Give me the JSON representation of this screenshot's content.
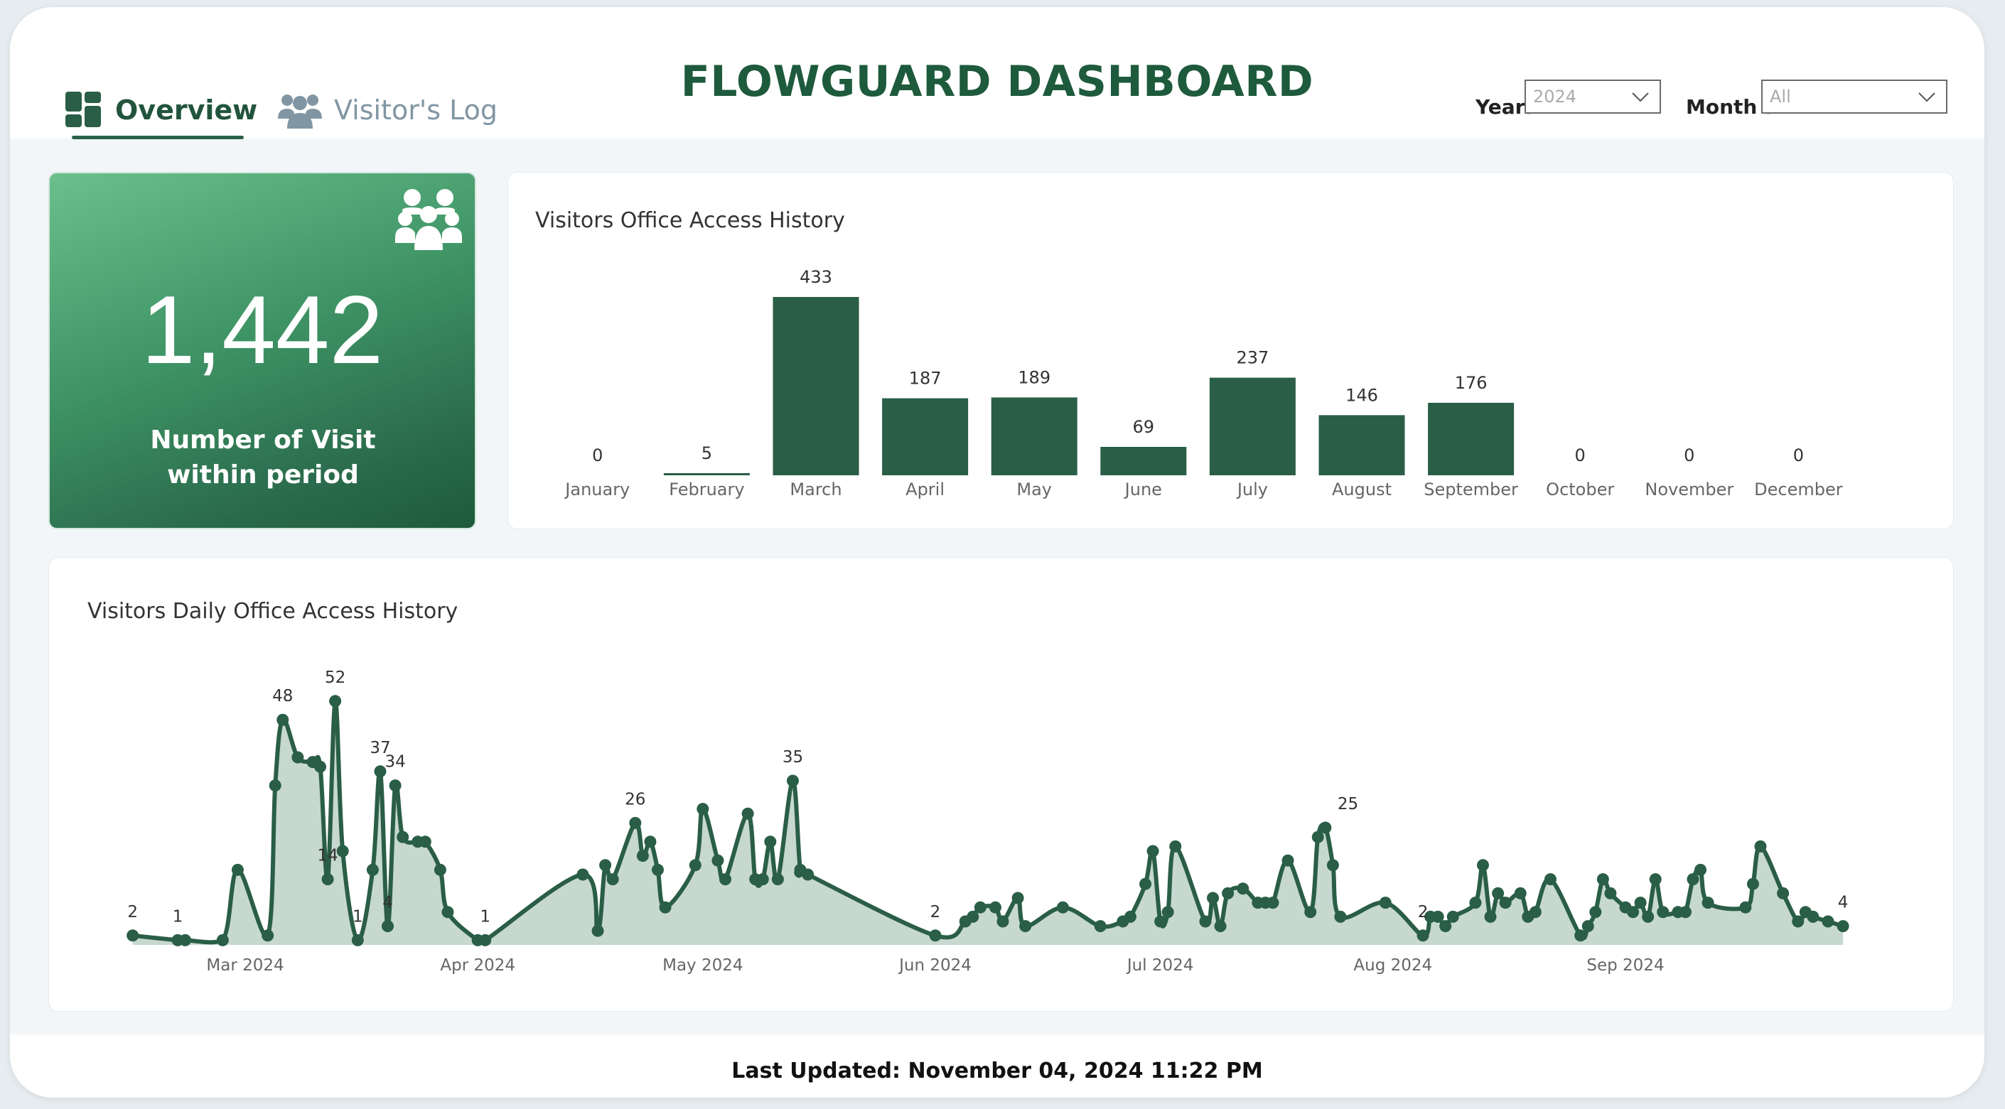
{
  "header": {
    "title": "FLOWGUARD DASHBOARD",
    "tabs": [
      {
        "label": "Overview",
        "icon": "dashboard-icon",
        "active": true
      },
      {
        "label": "Visitor's Log",
        "icon": "users-icon",
        "active": false
      }
    ]
  },
  "filters": {
    "year_label": "Year:",
    "year_value": "2024",
    "month_label": "Month :",
    "month_value": "All"
  },
  "kpi": {
    "value": "1,442",
    "label": "Number of Visit within period",
    "icon": "group-icon"
  },
  "monthly_chart_title": "Visitors Office Access History",
  "daily_chart_title": "Visitors Daily Office Access History",
  "footer": {
    "last_updated": "Last Updated: November 04, 2024 11:22 PM"
  },
  "colors": {
    "primary": "#2a5e46",
    "area_fill": "#c3d6cc",
    "title": "#1e5a3c"
  },
  "chart_data": [
    {
      "type": "bar",
      "title": "Visitors Office Access History",
      "categories": [
        "January",
        "February",
        "March",
        "April",
        "May",
        "June",
        "July",
        "August",
        "September",
        "October",
        "November",
        "December"
      ],
      "values": [
        0,
        5,
        433,
        187,
        189,
        69,
        237,
        146,
        176,
        0,
        0,
        0
      ],
      "ylim": [
        0,
        433
      ],
      "grid": false
    },
    {
      "type": "area",
      "title": "Visitors Daily Office Access History",
      "x_ticks": [
        "Mar 2024",
        "Apr 2024",
        "May 2024",
        "Jun 2024",
        "Jul 2024",
        "Aug 2024",
        "Sep 2024"
      ],
      "x_tick_dates": [
        "2024-03-01",
        "2024-04-01",
        "2024-05-01",
        "2024-06-01",
        "2024-07-01",
        "2024-08-01",
        "2024-09-01"
      ],
      "grid": false,
      "labeled_points": [
        {
          "date": "2024-02-15",
          "value": 2
        },
        {
          "date": "2024-02-21",
          "value": 1
        },
        {
          "date": "2024-03-06",
          "value": 48
        },
        {
          "date": "2024-03-12",
          "value": 14
        },
        {
          "date": "2024-03-13",
          "value": 52
        },
        {
          "date": "2024-03-16",
          "value": 1
        },
        {
          "date": "2024-03-19",
          "value": 37
        },
        {
          "date": "2024-03-20",
          "value": 4
        },
        {
          "date": "2024-03-21",
          "value": 34
        },
        {
          "date": "2024-04-02",
          "value": 1
        },
        {
          "date": "2024-04-22",
          "value": 26
        },
        {
          "date": "2024-05-13",
          "value": 35
        },
        {
          "date": "2024-06-01",
          "value": 2
        },
        {
          "date": "2024-07-26",
          "value": 25
        },
        {
          "date": "2024-08-05",
          "value": 2
        },
        {
          "date": "2024-09-30",
          "value": 4
        }
      ],
      "points": [
        {
          "date": "2024-02-15",
          "value": 2
        },
        {
          "date": "2024-02-21",
          "value": 1
        },
        {
          "date": "2024-02-22",
          "value": 1
        },
        {
          "date": "2024-02-27",
          "value": 1
        },
        {
          "date": "2024-02-29",
          "value": 16
        },
        {
          "date": "2024-03-04",
          "value": 2
        },
        {
          "date": "2024-03-05",
          "value": 34
        },
        {
          "date": "2024-03-06",
          "value": 48
        },
        {
          "date": "2024-03-08",
          "value": 40
        },
        {
          "date": "2024-03-10",
          "value": 39
        },
        {
          "date": "2024-03-11",
          "value": 38
        },
        {
          "date": "2024-03-12",
          "value": 14
        },
        {
          "date": "2024-03-13",
          "value": 52
        },
        {
          "date": "2024-03-14",
          "value": 20
        },
        {
          "date": "2024-03-16",
          "value": 1
        },
        {
          "date": "2024-03-18",
          "value": 16
        },
        {
          "date": "2024-03-19",
          "value": 37
        },
        {
          "date": "2024-03-20",
          "value": 4
        },
        {
          "date": "2024-03-21",
          "value": 34
        },
        {
          "date": "2024-03-22",
          "value": 23
        },
        {
          "date": "2024-03-24",
          "value": 22
        },
        {
          "date": "2024-03-25",
          "value": 22
        },
        {
          "date": "2024-03-27",
          "value": 16
        },
        {
          "date": "2024-03-28",
          "value": 7
        },
        {
          "date": "2024-04-01",
          "value": 1
        },
        {
          "date": "2024-04-02",
          "value": 1
        },
        {
          "date": "2024-04-15",
          "value": 15
        },
        {
          "date": "2024-04-17",
          "value": 3
        },
        {
          "date": "2024-04-18",
          "value": 17
        },
        {
          "date": "2024-04-19",
          "value": 14
        },
        {
          "date": "2024-04-22",
          "value": 26
        },
        {
          "date": "2024-04-23",
          "value": 19
        },
        {
          "date": "2024-04-24",
          "value": 22
        },
        {
          "date": "2024-04-25",
          "value": 16
        },
        {
          "date": "2024-04-26",
          "value": 8
        },
        {
          "date": "2024-04-30",
          "value": 17
        },
        {
          "date": "2024-05-01",
          "value": 29
        },
        {
          "date": "2024-05-03",
          "value": 18
        },
        {
          "date": "2024-05-04",
          "value": 14
        },
        {
          "date": "2024-05-07",
          "value": 28
        },
        {
          "date": "2024-05-08",
          "value": 14
        },
        {
          "date": "2024-05-09",
          "value": 14
        },
        {
          "date": "2024-05-10",
          "value": 22
        },
        {
          "date": "2024-05-11",
          "value": 14
        },
        {
          "date": "2024-05-13",
          "value": 35
        },
        {
          "date": "2024-05-14",
          "value": 16
        },
        {
          "date": "2024-05-15",
          "value": 15
        },
        {
          "date": "2024-06-01",
          "value": 2
        },
        {
          "date": "2024-06-05",
          "value": 5
        },
        {
          "date": "2024-06-06",
          "value": 6
        },
        {
          "date": "2024-06-07",
          "value": 8
        },
        {
          "date": "2024-06-09",
          "value": 8
        },
        {
          "date": "2024-06-10",
          "value": 5
        },
        {
          "date": "2024-06-12",
          "value": 10
        },
        {
          "date": "2024-06-13",
          "value": 4
        },
        {
          "date": "2024-06-18",
          "value": 8
        },
        {
          "date": "2024-06-23",
          "value": 4
        },
        {
          "date": "2024-06-26",
          "value": 5
        },
        {
          "date": "2024-06-27",
          "value": 6
        },
        {
          "date": "2024-06-29",
          "value": 13
        },
        {
          "date": "2024-06-30",
          "value": 20
        },
        {
          "date": "2024-07-01",
          "value": 5
        },
        {
          "date": "2024-07-02",
          "value": 7
        },
        {
          "date": "2024-07-03",
          "value": 21
        },
        {
          "date": "2024-07-07",
          "value": 5
        },
        {
          "date": "2024-07-08",
          "value": 10
        },
        {
          "date": "2024-07-09",
          "value": 4
        },
        {
          "date": "2024-07-10",
          "value": 11
        },
        {
          "date": "2024-07-12",
          "value": 12
        },
        {
          "date": "2024-07-14",
          "value": 9
        },
        {
          "date": "2024-07-15",
          "value": 9
        },
        {
          "date": "2024-07-16",
          "value": 9
        },
        {
          "date": "2024-07-18",
          "value": 18
        },
        {
          "date": "2024-07-21",
          "value": 7
        },
        {
          "date": "2024-07-22",
          "value": 23
        },
        {
          "date": "2024-07-23",
          "value": 25
        },
        {
          "date": "2024-07-24",
          "value": 17
        },
        {
          "date": "2024-07-25",
          "value": 6
        },
        {
          "date": "2024-07-31",
          "value": 9
        },
        {
          "date": "2024-08-05",
          "value": 2
        },
        {
          "date": "2024-08-06",
          "value": 6
        },
        {
          "date": "2024-08-07",
          "value": 6
        },
        {
          "date": "2024-08-08",
          "value": 4
        },
        {
          "date": "2024-08-09",
          "value": 6
        },
        {
          "date": "2024-08-12",
          "value": 9
        },
        {
          "date": "2024-08-13",
          "value": 17
        },
        {
          "date": "2024-08-14",
          "value": 6
        },
        {
          "date": "2024-08-15",
          "value": 11
        },
        {
          "date": "2024-08-16",
          "value": 9
        },
        {
          "date": "2024-08-18",
          "value": 11
        },
        {
          "date": "2024-08-19",
          "value": 6
        },
        {
          "date": "2024-08-20",
          "value": 7
        },
        {
          "date": "2024-08-22",
          "value": 14
        },
        {
          "date": "2024-08-26",
          "value": 2
        },
        {
          "date": "2024-08-27",
          "value": 4
        },
        {
          "date": "2024-08-28",
          "value": 7
        },
        {
          "date": "2024-08-29",
          "value": 14
        },
        {
          "date": "2024-08-30",
          "value": 11
        },
        {
          "date": "2024-09-01",
          "value": 8
        },
        {
          "date": "2024-09-02",
          "value": 7
        },
        {
          "date": "2024-09-03",
          "value": 9
        },
        {
          "date": "2024-09-04",
          "value": 6
        },
        {
          "date": "2024-09-05",
          "value": 14
        },
        {
          "date": "2024-09-06",
          "value": 7
        },
        {
          "date": "2024-09-08",
          "value": 7
        },
        {
          "date": "2024-09-09",
          "value": 7
        },
        {
          "date": "2024-09-10",
          "value": 14
        },
        {
          "date": "2024-09-11",
          "value": 16
        },
        {
          "date": "2024-09-12",
          "value": 9
        },
        {
          "date": "2024-09-17",
          "value": 8
        },
        {
          "date": "2024-09-18",
          "value": 13
        },
        {
          "date": "2024-09-19",
          "value": 21
        },
        {
          "date": "2024-09-22",
          "value": 11
        },
        {
          "date": "2024-09-24",
          "value": 5
        },
        {
          "date": "2024-09-25",
          "value": 7
        },
        {
          "date": "2024-09-26",
          "value": 6
        },
        {
          "date": "2024-09-28",
          "value": 5
        },
        {
          "date": "2024-09-30",
          "value": 4
        }
      ]
    }
  ]
}
